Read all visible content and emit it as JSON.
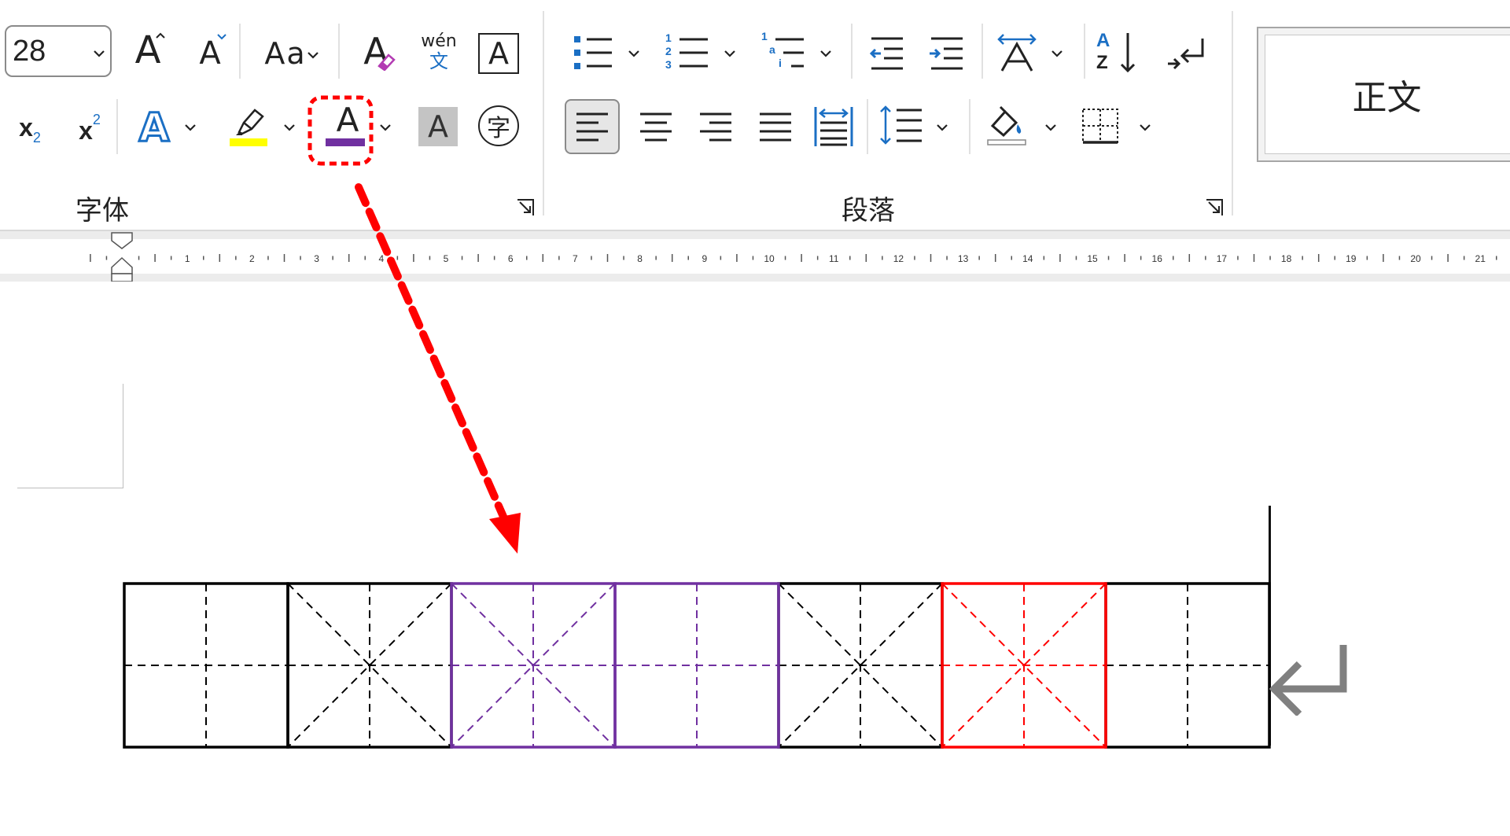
{
  "font_group": {
    "label": "字体",
    "font_size": "28",
    "grow_font_label": "A",
    "shrink_font_label": "A",
    "change_case_label": "Aa",
    "clear_format_label": "A",
    "phonetic_top": "wén",
    "phonetic_bottom": "文",
    "char_border_label": "A",
    "subscript_label": "x",
    "subscript_sub": "2",
    "superscript_label": "x",
    "superscript_sup": "2",
    "text_effects_label": "A",
    "font_color_label": "A",
    "char_shading_label": "A",
    "enclose_char_label": "字"
  },
  "paragraph_group": {
    "label": "段落",
    "numbering": {
      "n1": "1",
      "n2": "2",
      "n3": "3"
    },
    "multilevel": {
      "n1": "1",
      "a": "a",
      "i": "i"
    },
    "sort": {
      "top": "A",
      "bottom": "Z"
    }
  },
  "styles": {
    "normal_label": "正文"
  },
  "ruler": {
    "numbers": [
      "1",
      "2",
      "3",
      "4",
      "5",
      "6",
      "7",
      "8",
      "9",
      "10",
      "11",
      "12",
      "13",
      "14",
      "15",
      "16",
      "17",
      "18",
      "19",
      "20",
      "21"
    ]
  },
  "colors": {
    "font_color_swatch": "#7030a0",
    "highlight_swatch": "#ffff00",
    "annotation": "#ff0000",
    "grid_black": "#000000",
    "grid_purple": "#7030a0",
    "grid_red": "#ff0000"
  },
  "grid_cells": [
    {
      "type": "tian",
      "color": "black"
    },
    {
      "type": "mi",
      "color": "black"
    },
    {
      "type": "mi",
      "color": "purple"
    },
    {
      "type": "tian",
      "color": "purple"
    },
    {
      "type": "mi",
      "color": "black"
    },
    {
      "type": "mi",
      "color": "red"
    },
    {
      "type": "tian",
      "color": "black"
    }
  ]
}
